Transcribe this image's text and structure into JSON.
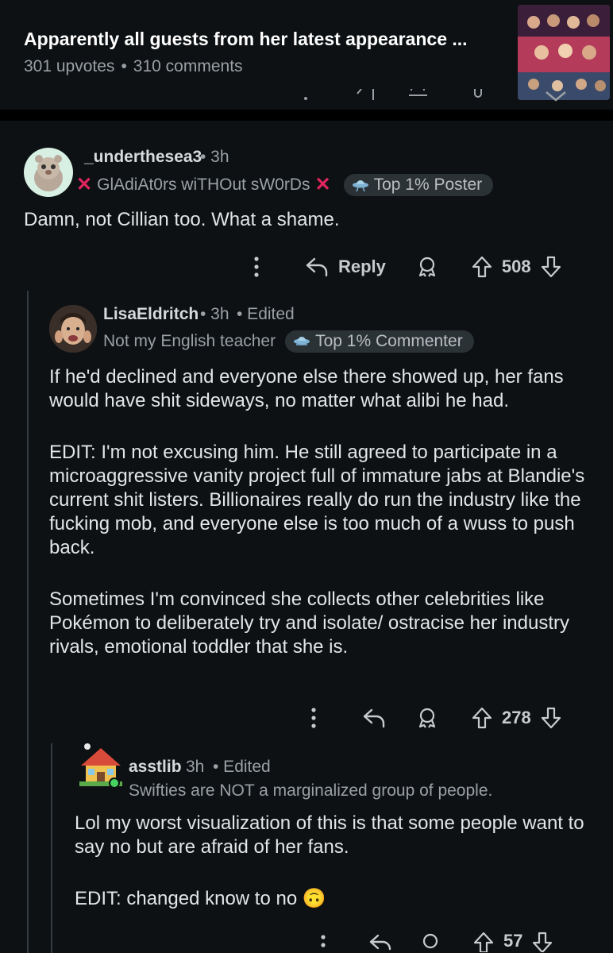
{
  "post": {
    "title": "Apparently all guests from her latest appearance ...",
    "upvotes": "301 upvotes",
    "comments": "310 comments",
    "separator": "•"
  },
  "comments": [
    {
      "username": "_underthesea3",
      "time": "• 3h",
      "flair": "GlAdiAt0rs wiTHOut sW0rDs",
      "badge": "Top 1% Poster",
      "body": [
        "Damn, not Cillian too. What a shame."
      ],
      "reply_label": "Reply",
      "score": "508"
    },
    {
      "username": "LisaEldritch",
      "time": "• 3h",
      "edited": "• Edited",
      "flair": "Not my English teacher",
      "badge": "Top 1% Commenter",
      "body": [
        "If he'd declined and everyone else there showed up, her fans would have shit sideways, no matter what alibi he had.",
        "EDIT: I'm not excusing him. He still agreed to participate in a microaggressive vanity project full of immature jabs at Blandie's current shit listers. Billionaires really do run the industry like the fucking mob, and everyone else is too much of a wuss to push back.",
        "Sometimes I'm convinced she collects other celebrities like Pokémon to deliberately try and isolate/ ostracise her industry rivals, emotional toddler that she is."
      ],
      "score": "278"
    },
    {
      "username": "asstlib",
      "time": "3h",
      "edited": "• Edited",
      "flair": "Swifties are NOT a marginalized group of people.",
      "body": [
        "Lol my worst visualization of this is that some people want to say no but are afraid of her fans.",
        "EDIT: changed know to no 🙃"
      ],
      "score": "57"
    }
  ],
  "colors": {
    "background": "#0e1113",
    "text": "#d7dadc",
    "muted": "#9aa0a6",
    "badge_bg": "#2a3236",
    "flair_x": "#e0245e"
  }
}
